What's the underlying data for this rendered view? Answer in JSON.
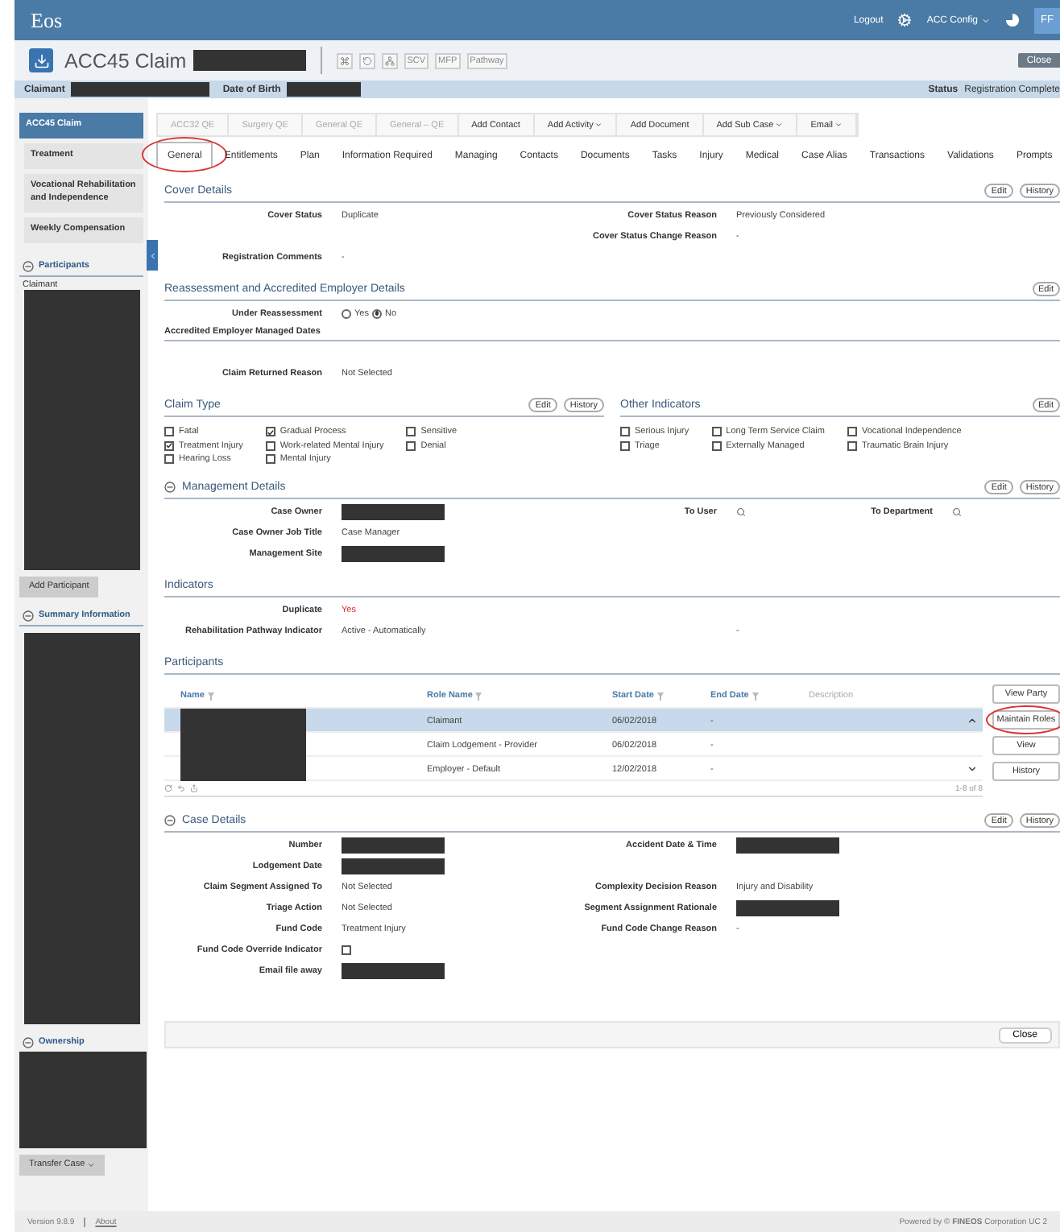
{
  "header": {
    "logo": "Eos",
    "logout": "Logout",
    "config_menu": "ACC Config",
    "avatar": "FF"
  },
  "title_bar": {
    "title": "ACC45 Claim",
    "tools": [
      "SCV",
      "MFP",
      "Pathway"
    ],
    "close": "Close"
  },
  "info_bar": {
    "claimant_label": "Claimant",
    "dob_label": "Date of Birth",
    "status_label": "Status",
    "status": "Registration Complete"
  },
  "sidebar": {
    "nav": [
      {
        "label": "ACC45 Claim",
        "selected": true
      },
      {
        "label": "Treatment",
        "selected": false
      },
      {
        "label": "Vocational Rehabilitation and Independence",
        "selected": false
      },
      {
        "label": "Weekly Compensation",
        "selected": false
      }
    ],
    "participants": {
      "title": "Participants",
      "expanded": true,
      "item": "Claimant",
      "button": "Add Participant"
    },
    "summary": {
      "title": "Summary Information",
      "expanded": true
    },
    "ownership": {
      "title": "Ownership",
      "expanded": true,
      "button": "Transfer Case"
    }
  },
  "actions": [
    {
      "label": "ACC32 QE",
      "disabled": true,
      "menu": false
    },
    {
      "label": "Surgery QE",
      "disabled": true,
      "menu": false
    },
    {
      "label": "General QE",
      "disabled": true,
      "menu": false
    },
    {
      "label": "General – QE",
      "disabled": true,
      "menu": false
    },
    {
      "label": "Add Contact",
      "disabled": false,
      "menu": false
    },
    {
      "label": "Add Activity",
      "disabled": false,
      "menu": true
    },
    {
      "label": "Add Document",
      "disabled": false,
      "menu": false
    },
    {
      "label": "Add Sub Case",
      "disabled": false,
      "menu": true
    },
    {
      "label": "Email",
      "disabled": false,
      "menu": true
    }
  ],
  "tabs": [
    {
      "label": "General",
      "selected": true,
      "circled": true
    },
    {
      "label": "Entitlements",
      "selected": false,
      "circled": false
    },
    {
      "label": "Plan",
      "selected": false,
      "circled": false
    },
    {
      "label": "Information Required",
      "selected": false,
      "circled": false
    },
    {
      "label": "Managing",
      "selected": false,
      "circled": false
    },
    {
      "label": "Contacts",
      "selected": false,
      "circled": false
    },
    {
      "label": "Documents",
      "selected": false,
      "circled": false
    },
    {
      "label": "Tasks",
      "selected": false,
      "circled": false
    },
    {
      "label": "Injury",
      "selected": false,
      "circled": false
    },
    {
      "label": "Medical",
      "selected": false,
      "circled": false
    },
    {
      "label": "Case Alias",
      "selected": false,
      "circled": false
    },
    {
      "label": "Transactions",
      "selected": false,
      "circled": false
    },
    {
      "label": "Validations",
      "selected": false,
      "circled": false
    },
    {
      "label": "Prompts",
      "selected": false,
      "circled": false
    }
  ],
  "sections": [
    {
      "kind": "fields",
      "title": "Cover Details",
      "buttons": [
        "Edit",
        "History"
      ],
      "rows": [
        {
          "left": {
            "label": "Cover Status",
            "value": "Duplicate",
            "kind": "text"
          },
          "right": {
            "label": "Cover Status Reason",
            "value": "Previously Considered",
            "kind": "text"
          }
        },
        {
          "right": {
            "label": "Cover Status Change Reason",
            "value": "-",
            "kind": "text"
          }
        },
        {
          "left": {
            "label": "Registration Comments",
            "value": "-",
            "kind": "text"
          }
        }
      ]
    },
    {
      "kind": "fields",
      "title": "Reassessment and Accredited Employer Details",
      "buttons": [
        "Edit"
      ],
      "rows": [
        {
          "left": {
            "label": "Under Reassessment",
            "kind": "radio",
            "options": [
              {
                "label": "Yes",
                "selected": false
              },
              {
                "label": "No",
                "selected": true
              }
            ]
          }
        },
        {
          "subheading": "Accredited Employer Managed Dates"
        },
        {
          "left": {
            "label": "Claim Returned Reason",
            "value": "Not Selected",
            "kind": "text"
          }
        }
      ]
    },
    {
      "kind": "checkbox_panels",
      "panels": [
        {
          "title": "Claim Type",
          "buttons": [
            "Edit",
            "History"
          ],
          "columns": [
            [
              {
                "label": "Fatal",
                "checked": false
              },
              {
                "label": "Treatment Injury",
                "checked": true
              },
              {
                "label": "Hearing Loss",
                "checked": false
              }
            ],
            [
              {
                "label": "Gradual Process",
                "checked": true
              },
              {
                "label": "Work-related Mental Injury",
                "checked": false
              },
              {
                "label": "Mental Injury",
                "checked": false
              }
            ],
            [
              {
                "label": "Sensitive",
                "checked": false
              },
              {
                "label": "Denial",
                "checked": false
              }
            ]
          ]
        },
        {
          "title": "Other Indicators",
          "buttons": [
            "Edit"
          ],
          "columns": [
            [
              {
                "label": "Serious Injury",
                "checked": false
              },
              {
                "label": "Triage",
                "checked": false
              }
            ],
            [
              {
                "label": "Long Term Service Claim",
                "checked": false
              },
              {
                "label": "Externally Managed",
                "checked": false
              }
            ],
            [
              {
                "label": "Vocational Independence",
                "checked": false
              },
              {
                "label": "Traumatic Brain Injury",
                "checked": false
              }
            ]
          ]
        }
      ]
    },
    {
      "kind": "fields",
      "title": "Management Details",
      "expanded": true,
      "buttons": [
        "Edit",
        "History"
      ],
      "rows": [
        {
          "left": {
            "label": "Case Owner",
            "kind": "redacted"
          },
          "right": {
            "label": "To User",
            "kind": "search"
          },
          "far": {
            "label": "To Department",
            "kind": "search"
          }
        },
        {
          "left": {
            "label": "Case Owner Job Title",
            "value": "Case Manager",
            "kind": "text"
          }
        },
        {
          "left": {
            "label": "Management Site",
            "kind": "redacted"
          }
        }
      ]
    },
    {
      "kind": "fields",
      "title": "Indicators",
      "rows": [
        {
          "left": {
            "label": "Duplicate",
            "value": "Yes",
            "kind": "alert"
          }
        },
        {
          "left": {
            "label": "Rehabilitation Pathway Indicator",
            "value": "Active - Automatically",
            "kind": "text"
          },
          "right": {
            "value": "-",
            "kind": "text"
          }
        }
      ]
    },
    {
      "kind": "table",
      "title": "Participants",
      "columns": [
        {
          "label": "Name",
          "filter": true
        },
        {
          "label": "Role Name",
          "filter": true
        },
        {
          "label": "Start Date",
          "filter": true
        },
        {
          "label": "End Date",
          "filter": true
        },
        {
          "label": "Description",
          "filter": false
        }
      ],
      "rows": [
        {
          "role": "Claimant",
          "start": "06/02/2018",
          "end": "-",
          "selected": true
        },
        {
          "role": "Claim Lodgement - Provider",
          "start": "06/02/2018",
          "end": "-",
          "selected": false
        },
        {
          "role": "Employer - Default",
          "start": "12/02/2018",
          "end": "-",
          "selected": false
        }
      ],
      "pager": "1-8 of 8",
      "side_buttons": [
        {
          "label": "View Party",
          "circled": false
        },
        {
          "label": "Maintain Roles",
          "circled": true
        },
        {
          "label": "View",
          "circled": false
        },
        {
          "label": "History",
          "circled": false
        }
      ]
    },
    {
      "kind": "fields",
      "title": "Case Details",
      "expanded": true,
      "buttons": [
        "Edit",
        "History"
      ],
      "rows": [
        {
          "left": {
            "label": "Number",
            "kind": "redacted"
          },
          "right": {
            "label": "Accident Date & Time",
            "kind": "redacted"
          }
        },
        {
          "left": {
            "label": "Lodgement Date",
            "kind": "redacted"
          }
        },
        {
          "left": {
            "label": "Claim Segment Assigned To",
            "value": "Not Selected",
            "kind": "text"
          },
          "right": {
            "label": "Complexity Decision Reason",
            "value": "Injury and Disability",
            "kind": "text"
          }
        },
        {
          "left": {
            "label": "Triage Action",
            "value": "Not Selected",
            "kind": "text"
          },
          "right": {
            "label": "Segment Assignment Rationale",
            "kind": "redacted"
          }
        },
        {
          "left": {
            "label": "Fund Code",
            "value": "Treatment Injury",
            "kind": "text"
          },
          "right": {
            "label": "Fund Code Change Reason",
            "value": "-",
            "kind": "text"
          }
        },
        {
          "left": {
            "label": "Fund Code Override Indicator",
            "kind": "checkbox",
            "checked": false
          }
        },
        {
          "left": {
            "label": "Email file away",
            "kind": "redacted"
          }
        }
      ]
    }
  ],
  "bottom_bar": {
    "close": "Close"
  },
  "footer": {
    "version": "Version 9.8.9",
    "about": "About",
    "powered": "Powered by © **FINEOS** Corporation UC 2"
  }
}
